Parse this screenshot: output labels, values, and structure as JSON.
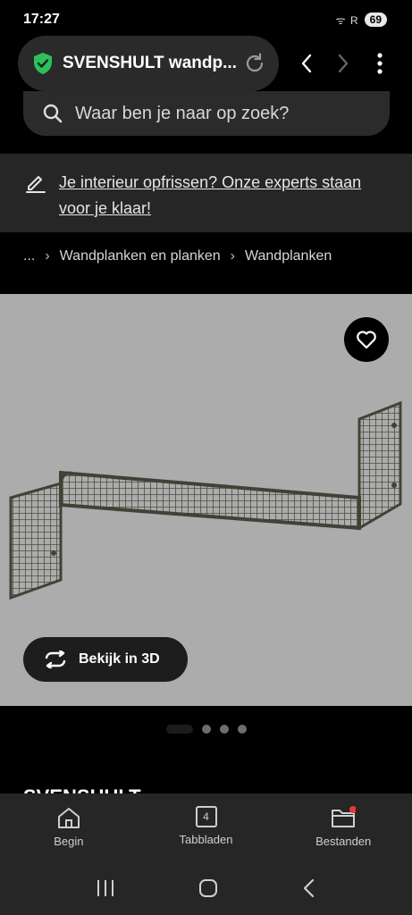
{
  "status": {
    "time": "17:27",
    "signal_text": "ᯤ R",
    "battery": "69"
  },
  "browser": {
    "url_title": "SVENSHULT wandp...",
    "tab_count": "4"
  },
  "search": {
    "placeholder": "Waar ben je naar op zoek?"
  },
  "promo": {
    "text": "Je interieur opfrissen? Onze experts staan voor je klaar!"
  },
  "breadcrumb": {
    "items": [
      "...",
      "Wandplanken en planken",
      "Wandplanken"
    ]
  },
  "product": {
    "view_3d_label": "Bekijk in 3D",
    "title_peek": "SVENSHULT",
    "image_count": 4,
    "active_image": 1
  },
  "bottom_nav": {
    "items": [
      {
        "label": "Begin",
        "icon": "home-icon"
      },
      {
        "label": "Tabbladen",
        "icon": "tabs-icon"
      },
      {
        "label": "Bestanden",
        "icon": "folder-icon"
      }
    ]
  },
  "colors": {
    "page_bg": "#000000",
    "image_bg": "#acacac",
    "shield_green": "#2fbf5b",
    "notification_dot": "#e53935",
    "shelf": "#5a5e4e"
  }
}
